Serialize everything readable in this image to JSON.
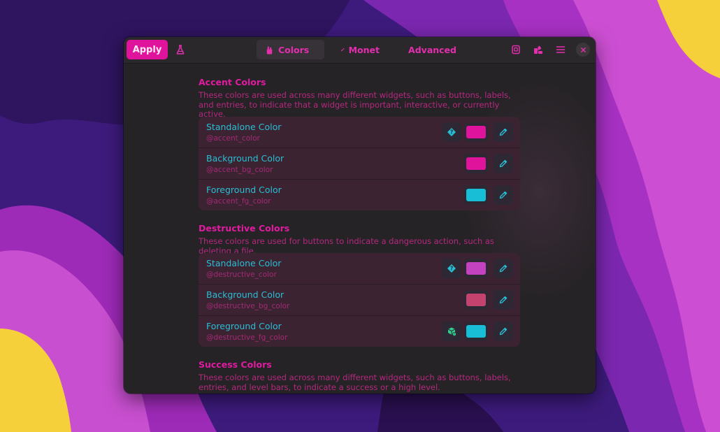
{
  "colors": {
    "accent": "#e0139c",
    "text_cyan": "#28bfd6",
    "desc_pink": "#b5287f"
  },
  "headerbar": {
    "apply_label": "Apply",
    "tabs": [
      {
        "label": "Colors",
        "icon": "paint-bucket-icon",
        "active": true
      },
      {
        "label": "Monet",
        "icon": "eyedropper-icon",
        "active": false
      },
      {
        "label": "Advanced",
        "icon": "gear-icon",
        "active": false
      }
    ],
    "icons": [
      "flask-icon",
      "presets-icon",
      "palette-icon",
      "menu-icon",
      "close-icon"
    ]
  },
  "sections": [
    {
      "title": "Accent Colors",
      "description": "These colors are used across many different widgets, such as buttons, labels, and entries, to indicate that a widget is important, interactive, or currently active.",
      "rows": [
        {
          "title": "Standalone Color",
          "var": "@accent_color",
          "color": "#e0139c",
          "extra_icon": "help-icon"
        },
        {
          "title": "Background Color",
          "var": "@accent_bg_color",
          "color": "#e0139c",
          "extra_icon": ""
        },
        {
          "title": "Foreground Color",
          "var": "@accent_fg_color",
          "color": "#18bdd6",
          "extra_icon": ""
        }
      ]
    },
    {
      "title": "Destructive Colors",
      "description": "These colors are used for buttons to indicate a dangerous action, such as deleting a file.",
      "rows": [
        {
          "title": "Standalone Color",
          "var": "@destructive_color",
          "color": "#c441c0",
          "extra_icon": "help-icon"
        },
        {
          "title": "Background Color",
          "var": "@destructive_bg_color",
          "color": "#c4426e",
          "extra_icon": ""
        },
        {
          "title": "Foreground Color",
          "var": "@destructive_fg_color",
          "color": "#18bdd6",
          "extra_icon": "contrast-warning-icon"
        }
      ]
    },
    {
      "title": "Success Colors",
      "description": "These colors are used across many different widgets, such as buttons, labels, entries, and level bars, to indicate a success or a high level."
    }
  ]
}
